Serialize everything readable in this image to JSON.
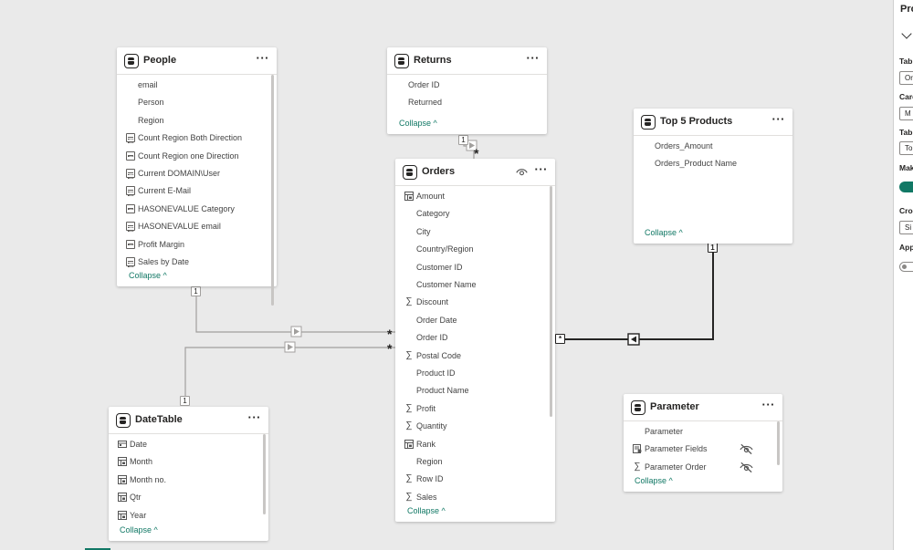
{
  "tables": {
    "people": {
      "title": "People",
      "fields": [
        {
          "name": "email",
          "icon": "none"
        },
        {
          "name": "Person",
          "icon": "none"
        },
        {
          "name": "Region",
          "icon": "none"
        },
        {
          "name": "Count Region Both Direction",
          "icon": "calculator"
        },
        {
          "name": "Count Region one Direction",
          "icon": "calculator"
        },
        {
          "name": "Current DOMAIN\\User",
          "icon": "calculator"
        },
        {
          "name": "Current E-Mail",
          "icon": "calculator"
        },
        {
          "name": "HASONEVALUE Category",
          "icon": "calculator"
        },
        {
          "name": "HASONEVALUE email",
          "icon": "calculator"
        },
        {
          "name": "Profit Margin",
          "icon": "calculator"
        },
        {
          "name": "Sales by Date",
          "icon": "calculator"
        }
      ],
      "collapse": "Collapse ^"
    },
    "returns": {
      "title": "Returns",
      "fields": [
        {
          "name": "Order ID",
          "icon": "none"
        },
        {
          "name": "Returned",
          "icon": "none"
        }
      ],
      "collapse": "Collapse ^"
    },
    "orders": {
      "title": "Orders",
      "fields": [
        {
          "name": "Amount",
          "icon": "hierarchy"
        },
        {
          "name": "Category",
          "icon": "none"
        },
        {
          "name": "City",
          "icon": "none"
        },
        {
          "name": "Country/Region",
          "icon": "none"
        },
        {
          "name": "Customer ID",
          "icon": "none"
        },
        {
          "name": "Customer Name",
          "icon": "none"
        },
        {
          "name": "Discount",
          "icon": "sigma"
        },
        {
          "name": "Order Date",
          "icon": "none"
        },
        {
          "name": "Order ID",
          "icon": "none"
        },
        {
          "name": "Postal Code",
          "icon": "sigma"
        },
        {
          "name": "Product ID",
          "icon": "none"
        },
        {
          "name": "Product Name",
          "icon": "none"
        },
        {
          "name": "Profit",
          "icon": "sigma"
        },
        {
          "name": "Quantity",
          "icon": "sigma"
        },
        {
          "name": "Rank",
          "icon": "hierarchy"
        },
        {
          "name": "Region",
          "icon": "none"
        },
        {
          "name": "Row ID",
          "icon": "sigma"
        },
        {
          "name": "Sales",
          "icon": "sigma"
        }
      ],
      "collapse": "Collapse ^"
    },
    "top5": {
      "title": "Top 5 Products",
      "fields": [
        {
          "name": "Orders_Amount",
          "icon": "none"
        },
        {
          "name": "Orders_Product Name",
          "icon": "none"
        }
      ],
      "collapse": "Collapse ^"
    },
    "parameter": {
      "title": "Parameter",
      "fields": [
        {
          "name": "Parameter",
          "icon": "none",
          "hidden": false
        },
        {
          "name": "Parameter Fields",
          "icon": "parameter",
          "hidden": true
        },
        {
          "name": "Parameter Order",
          "icon": "sigma",
          "hidden": true
        }
      ],
      "collapse": "Collapse ^"
    },
    "datetable": {
      "title": "DateTable",
      "fields": [
        {
          "name": "Date",
          "icon": "calendar"
        },
        {
          "name": "Month",
          "icon": "hierarchy"
        },
        {
          "name": "Month no.",
          "icon": "hierarchy"
        },
        {
          "name": "Qtr",
          "icon": "hierarchy"
        },
        {
          "name": "Year",
          "icon": "hierarchy"
        }
      ],
      "collapse": "Collapse ^"
    }
  },
  "cardinality": {
    "people_one": "1",
    "people_orders_many": "*",
    "datetable_one": "1",
    "datetable_orders_many": "*",
    "returns_one": "1",
    "returns_many": "*",
    "orders_top5_many": "*",
    "top5_one": "1"
  },
  "more_label": "···",
  "properties_pane": {
    "title": "Pro",
    "labels": [
      "Tab",
      "Card",
      "Tab",
      "Mak",
      "Cro",
      "App"
    ],
    "inputs": [
      "Or",
      "M",
      "To",
      "Si"
    ]
  },
  "colors": {
    "accent": "#117865",
    "line": "#a19f9d",
    "active_line": "#252423"
  }
}
